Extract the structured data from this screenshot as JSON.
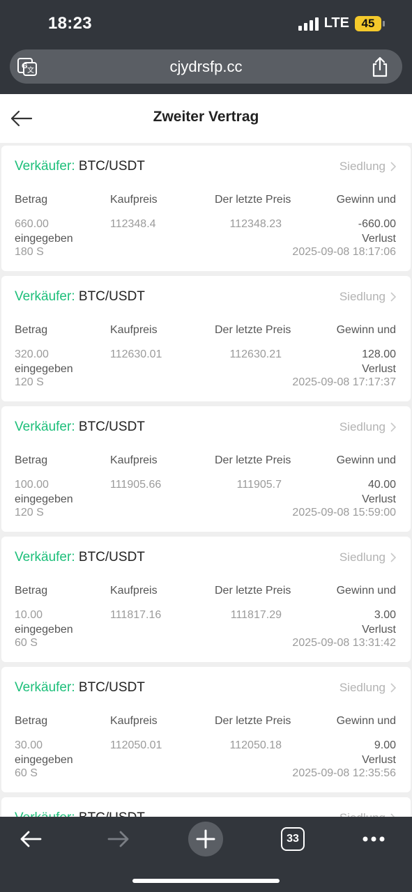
{
  "status_bar": {
    "time": "18:23",
    "network": "LTE",
    "battery": "45"
  },
  "browser": {
    "url": "cjydrsfp.cc",
    "tabs_count": "33"
  },
  "page": {
    "title": "Zweiter Vertrag"
  },
  "headers": {
    "amount": "Betrag",
    "buy_price": "Kaufpreis",
    "last_price": "Der letzte Preis",
    "pnl": "Gewinn und",
    "amount_sub": "eingegeben",
    "pnl_sub": "Verlust"
  },
  "orders": [
    {
      "side": "Verkäufer:",
      "pair": "BTC/USDT",
      "action": "Siedlung",
      "amount": "660.00",
      "buy_price": "112348.4",
      "last_price": "112348.23",
      "pnl": "-660.00",
      "duration": "180 S",
      "time": "2025-09-08 18:17:06"
    },
    {
      "side": "Verkäufer:",
      "pair": "BTC/USDT",
      "action": "Siedlung",
      "amount": "320.00",
      "buy_price": "112630.01",
      "last_price": "112630.21",
      "pnl": "128.00",
      "duration": "120 S",
      "time": "2025-09-08 17:17:37"
    },
    {
      "side": "Verkäufer:",
      "pair": "BTC/USDT",
      "action": "Siedlung",
      "amount": "100.00",
      "buy_price": "111905.66",
      "last_price": "111905.7",
      "pnl": "40.00",
      "duration": "120 S",
      "time": "2025-09-08 15:59:00"
    },
    {
      "side": "Verkäufer:",
      "pair": "BTC/USDT",
      "action": "Siedlung",
      "amount": "10.00",
      "buy_price": "111817.16",
      "last_price": "111817.29",
      "pnl": "3.00",
      "duration": "60 S",
      "time": "2025-09-08 13:31:42"
    },
    {
      "side": "Verkäufer:",
      "pair": "BTC/USDT",
      "action": "Siedlung",
      "amount": "30.00",
      "buy_price": "112050.01",
      "last_price": "112050.18",
      "pnl": "9.00",
      "duration": "60 S",
      "time": "2025-09-08 12:35:56"
    },
    {
      "side": "Verkäufer:",
      "pair": "BTC/USDT",
      "action": "Siedlung"
    }
  ],
  "colors": {
    "accent_green": "#1dbf7a",
    "chrome": "#32363c"
  },
  "icons": [
    "translate-icon",
    "share-icon",
    "back-arrow-icon",
    "chevron-right-icon",
    "forward-arrow-icon",
    "plus-icon",
    "more-icon"
  ]
}
